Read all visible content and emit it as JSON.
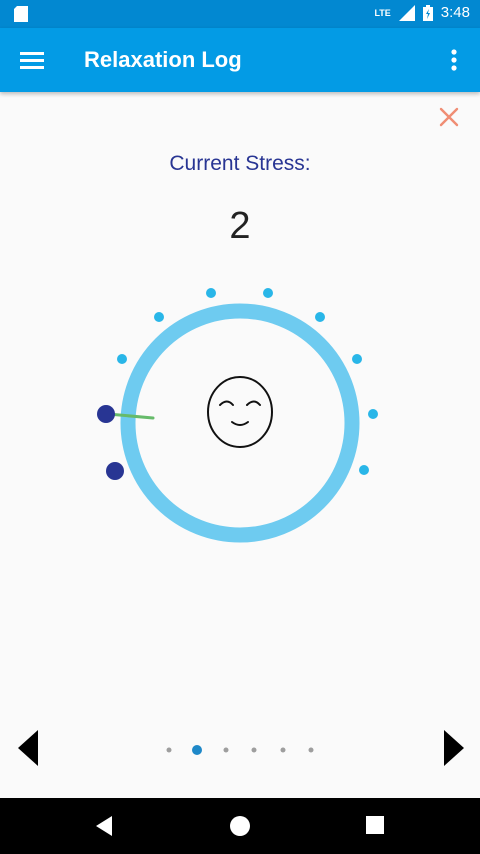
{
  "app": {
    "title": "Relaxation Log"
  },
  "status": {
    "time": "3:48",
    "network": "LTE",
    "colors": {
      "statusbar": "#0288d1",
      "appbar": "#039be5"
    }
  },
  "stress": {
    "label": "Current Stress:",
    "value": "2",
    "level": 2
  },
  "dial": {
    "ring_color": "#6ecbf0",
    "dot_color": "#29b6e8",
    "active_color": "#283593",
    "handle_color": "#66bb6a"
  },
  "pager": {
    "pages": 6,
    "current": 2
  },
  "icons": {
    "menu": "hamburger-menu-icon",
    "more": "overflow-menu-icon",
    "close": "close-icon",
    "prev": "chevron-left-icon",
    "next": "chevron-right-icon",
    "face": "calm-face-icon"
  }
}
